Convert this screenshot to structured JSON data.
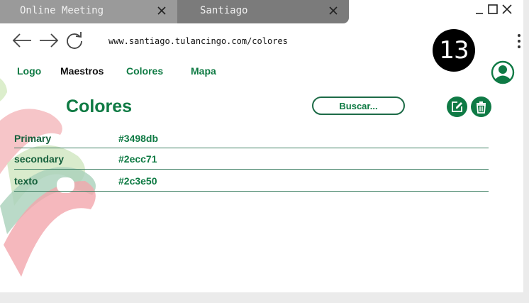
{
  "browser": {
    "tabs": [
      {
        "label": "Online Meeting"
      },
      {
        "label": "Santiago"
      }
    ],
    "url": "www.santiago.tulancingo.com/colores"
  },
  "overlay": {
    "badge": "13"
  },
  "nav": {
    "items": [
      {
        "label": "Logo"
      },
      {
        "label": "Maestros"
      },
      {
        "label": "Colores"
      },
      {
        "label": "Mapa"
      }
    ]
  },
  "page": {
    "title": "Colores",
    "search_label": "Buscar..."
  },
  "colors_table": {
    "rows": [
      {
        "name": "Primary",
        "value": "#3498db"
      },
      {
        "name": "secondary",
        "value": "#2ecc71"
      },
      {
        "name": "texto",
        "value": "#2c3e50"
      }
    ]
  },
  "theme": {
    "accent": "#0e7a43",
    "tab_active": "#7b7b7b",
    "tab_inactive": "#9a9a9a"
  }
}
